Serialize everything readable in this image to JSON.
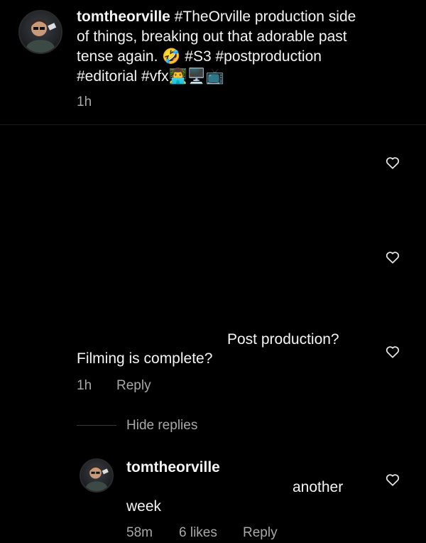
{
  "post": {
    "username": "tomtheorville",
    "caption_line1": "#TheOrville production side",
    "caption_line2": "of things, breaking out that adorable past",
    "caption_line3a": "tense again.",
    "caption_emoji_laugh": "🤣",
    "caption_line3b": "#S3 #postproduction",
    "caption_line4": "#editorial #vfx",
    "caption_emoji_tail": "👨‍💻🖥️📺",
    "time": "1h"
  },
  "comment": {
    "text_line1": "Post production?",
    "text_line2": "Filming is complete?",
    "time": "1h",
    "reply_label": "Reply",
    "hide_replies_label": "Hide replies"
  },
  "reply": {
    "username": "tomtheorville",
    "text_part1": "another",
    "text_part2": "week",
    "time": "58m",
    "likes": "6 likes",
    "reply_label": "Reply"
  }
}
